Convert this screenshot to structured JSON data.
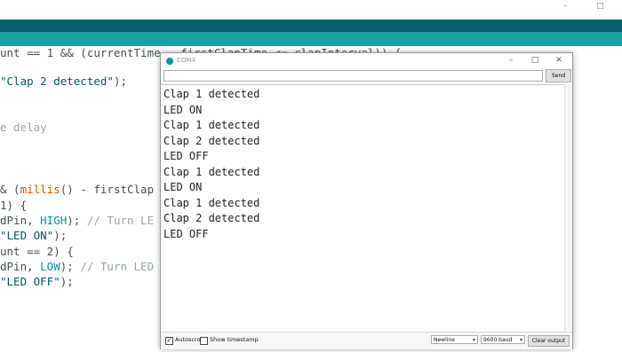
{
  "ide": {
    "window_controls": {
      "minimize": "–",
      "maximize": "□"
    },
    "code_lines": [
      [
        {
          "t": "unt == 1 && (currentTime - firstClapTime <= clapInterval)) {",
          "c": ""
        }
      ],
      [
        {
          "t": "\"Clap 2 detected\"",
          "c": "str"
        },
        {
          "t": ");",
          "c": ""
        }
      ],
      [
        {
          "t": "e delay",
          "c": "cm"
        }
      ],
      [
        {
          "t": "& (",
          "c": ""
        },
        {
          "t": "millis",
          "c": "kw"
        },
        {
          "t": "() - firstClap",
          "c": ""
        }
      ],
      [
        {
          "t": "1) {",
          "c": ""
        }
      ],
      [
        {
          "t": "dPin, ",
          "c": ""
        },
        {
          "t": "HIGH",
          "c": "const"
        },
        {
          "t": "); ",
          "c": ""
        },
        {
          "t": "// Turn LE",
          "c": "cm"
        }
      ],
      [
        {
          "t": "\"LED ON\"",
          "c": "str"
        },
        {
          "t": ");",
          "c": ""
        }
      ],
      [
        {
          "t": "unt == 2) {",
          "c": ""
        }
      ],
      [
        {
          "t": "dPin, ",
          "c": ""
        },
        {
          "t": "LOW",
          "c": "const"
        },
        {
          "t": "); ",
          "c": ""
        },
        {
          "t": "// Turn LED",
          "c": "cm"
        }
      ],
      [
        {
          "t": "\"LED OFF\"",
          "c": "str"
        },
        {
          "t": ");",
          "c": ""
        }
      ]
    ]
  },
  "monitor": {
    "title": "COM4",
    "buttons": {
      "minimize": "–",
      "maximize": "□",
      "close": "✕"
    },
    "send_label": "Send",
    "input_value": "",
    "output_lines": [
      "Clap 1 detected",
      "LED ON",
      "Clap 1 detected",
      "Clap 2 detected",
      "LED OFF",
      "Clap 1 detected",
      "LED ON",
      "Clap 1 detected",
      "Clap 2 detected",
      "LED OFF"
    ],
    "autoscroll_label": "Autoscroll",
    "autoscroll_checked": "✓",
    "timestamp_label": "Show timestamp",
    "line_ending": "Newline",
    "baud_rate": "9600 baud",
    "clear_label": "Clear output"
  },
  "colors": {
    "teal_dark": "#006468",
    "teal_light": "#17a1a5",
    "keyword": "#d35400",
    "constant": "#00979c"
  }
}
